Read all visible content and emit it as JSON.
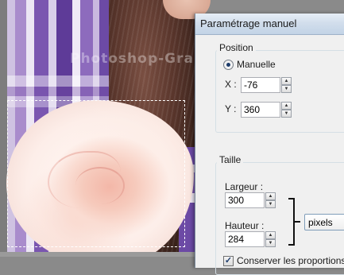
{
  "watermark": "Photoshop-Graphic",
  "dialog": {
    "title": "Paramétrage manuel",
    "position": {
      "group_label": "Position",
      "mode_label": "Manuelle",
      "x_label": "X :",
      "x_value": "-76",
      "y_label": "Y :",
      "y_value": "360"
    },
    "taille": {
      "group_label": "Taille",
      "largeur_label": "Largeur :",
      "largeur_value": "300",
      "hauteur_label": "Hauteur :",
      "hauteur_value": "284",
      "units": "pixels"
    },
    "keep_proportions_label": "Conserver les proportions",
    "keep_proportions_checked": "✓"
  }
}
